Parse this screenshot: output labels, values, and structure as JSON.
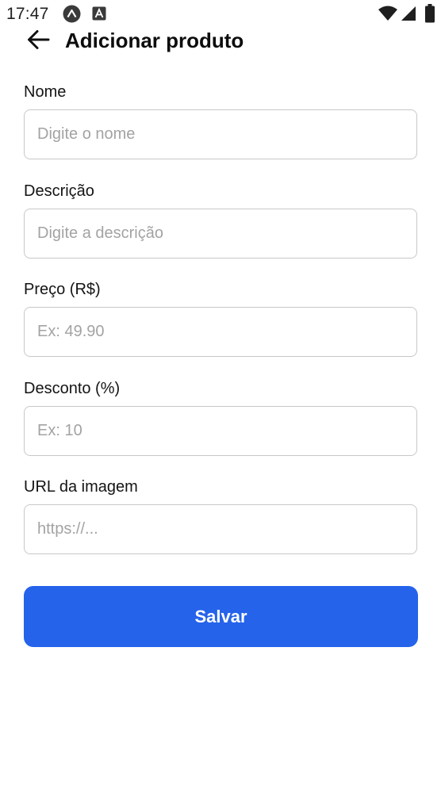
{
  "status_bar": {
    "time": "17:47",
    "icons": [
      "android-app-icon",
      "a-square-app-icon",
      "wifi-icon",
      "signal-icon",
      "battery-icon"
    ]
  },
  "header": {
    "back_icon": "arrow-left-icon",
    "title": "Adicionar produto"
  },
  "form": {
    "fields": [
      {
        "label": "Nome",
        "placeholder": "Digite o nome",
        "value": ""
      },
      {
        "label": "Descrição",
        "placeholder": "Digite a descrição",
        "value": ""
      },
      {
        "label": "Preço (R$)",
        "placeholder": "Ex: 49.90",
        "value": ""
      },
      {
        "label": "Desconto (%)",
        "placeholder": "Ex: 10",
        "value": ""
      },
      {
        "label": "URL da imagem",
        "placeholder": "https://...",
        "value": ""
      }
    ],
    "save_label": "Salvar"
  },
  "colors": {
    "accent": "#2563eb",
    "input_border": "#c8c8c8",
    "placeholder": "#a3a3a3"
  }
}
